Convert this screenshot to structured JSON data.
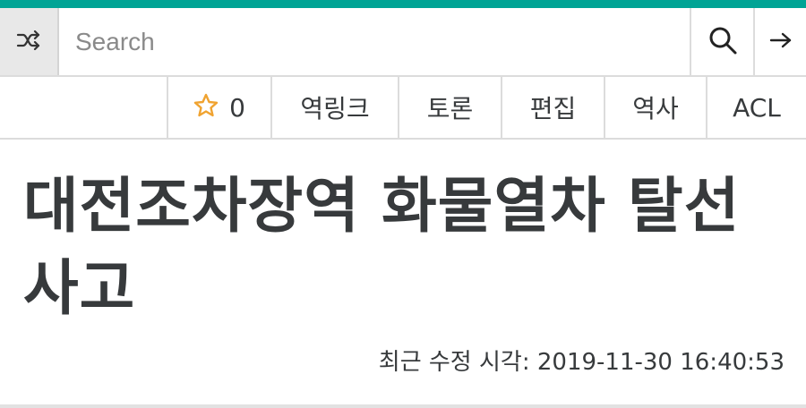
{
  "search": {
    "placeholder": "Search"
  },
  "tabs": {
    "star_count": "0",
    "backlinks": "역링크",
    "discussion": "토론",
    "edit": "편집",
    "history": "역사",
    "acl": "ACL"
  },
  "icons": {
    "random": "shuffle-icon",
    "search": "search-icon",
    "go": "arrow-right-icon",
    "star": "star-outline-icon"
  },
  "colors": {
    "accent": "#00a495",
    "star": "#f0a330"
  },
  "article": {
    "title": "대전조차장역 화물열차 탈선사고",
    "last_edited": "최근 수정 시각: 2019-11-30 16:40:53"
  }
}
